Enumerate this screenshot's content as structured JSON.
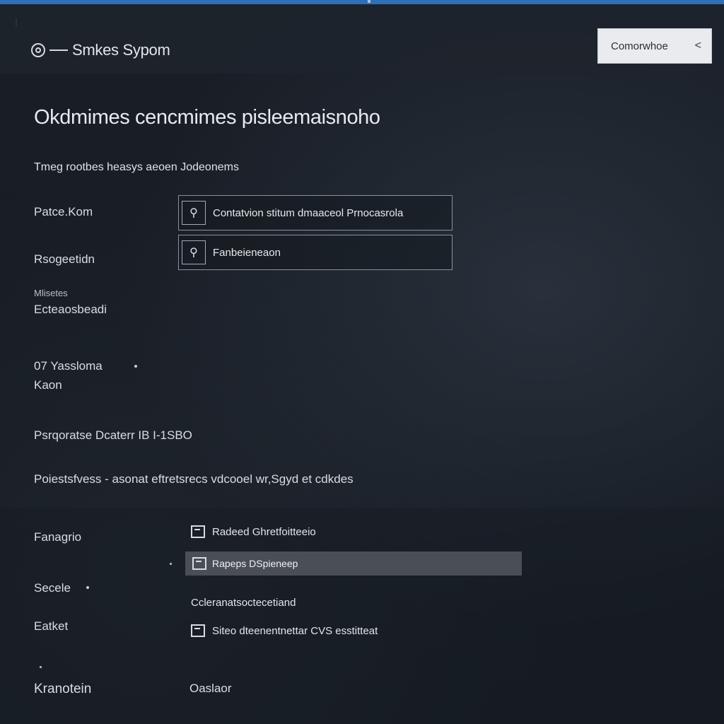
{
  "header": {
    "brand_name": "Smkes Sypom",
    "action_button_label": "Comorwhoe",
    "action_button_chevron": "<"
  },
  "main": {
    "title": "Okdmimes cencmimes pisleemaisnoho",
    "subtitle": "Tmeg rootbes heasys aeoen Jodeonems",
    "fields": [
      {
        "label": "Patce.Kom",
        "option_icon": "lock-icon",
        "option_text": "Contatvion stitum dmaaceol Prnocasrola"
      },
      {
        "label": "Rsogeetidn",
        "option_icon": "lock-icon",
        "option_text": "Fanbeieneaon"
      }
    ],
    "meta_small": "Mlisetes",
    "meta_value": "Ecteaosbeadi",
    "status_line1": "07  Yassloma",
    "status_line2": "Kaon",
    "product_line": "Psrqoratse Dcaterr IB  I-1SBO",
    "description": "Poiestsfvess - asonat eftretsrecs vdcooel wr,Sgyd et cdkdes"
  },
  "lower": {
    "labels": [
      "Fanagrio",
      "Secele",
      "Eatket",
      "Kranotein"
    ],
    "rows": [
      {
        "icon": "document-icon",
        "text": "Radeed Ghretfoitteeio"
      },
      {
        "icon": "document-icon",
        "text": "Rapeps DSpieneep",
        "selected": true
      },
      {
        "icon": "",
        "text": "Ccleranatsoctecetiand"
      },
      {
        "icon": "document-icon",
        "text": "Siteo dteenentnettar CVS esstitteat"
      }
    ],
    "footer_value": "Oaslaor"
  }
}
